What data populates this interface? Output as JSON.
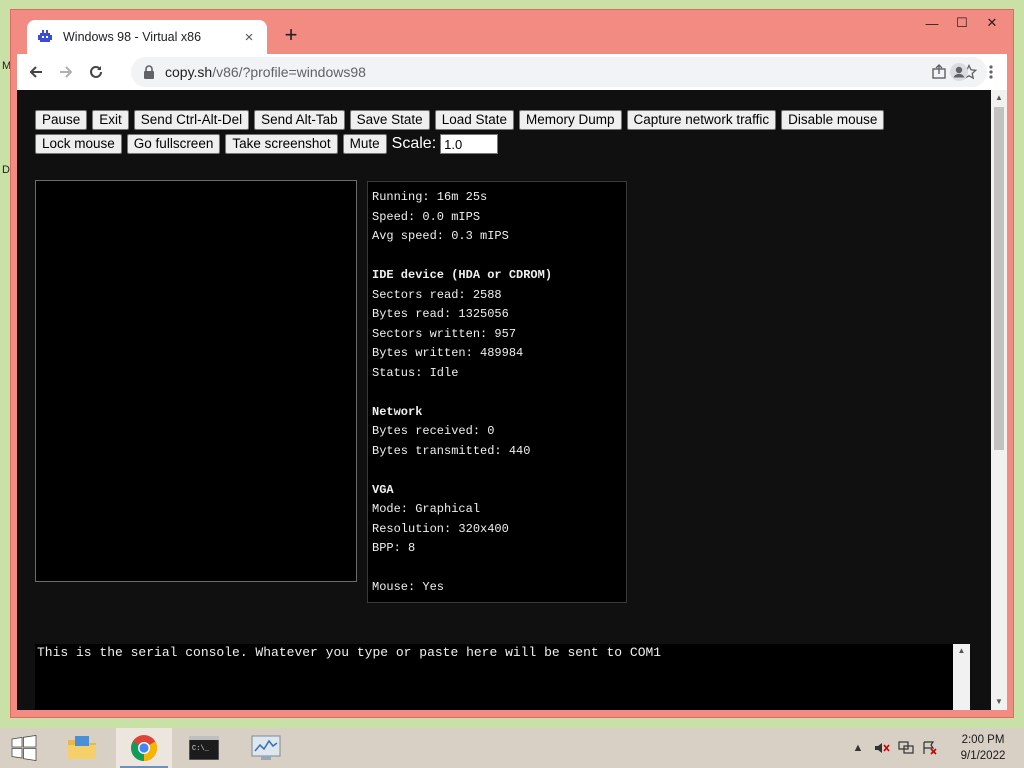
{
  "desktop": {
    "edge_letters": [
      "M",
      "D"
    ]
  },
  "browser": {
    "tab_title": "Windows 98 - Virtual x86",
    "tab_close": "×",
    "new_tab": "+",
    "window_controls": {
      "minimize": "—",
      "maximize": "☐",
      "close": "✕"
    },
    "url_host": "copy.sh",
    "url_path": "/v86/?profile=windows98",
    "icons": [
      "back-icon",
      "forward-icon",
      "reload-icon",
      "lock-icon",
      "share-icon",
      "star-icon",
      "profile-icon",
      "menu-icon"
    ]
  },
  "controls": {
    "row1": [
      "Pause",
      "Exit",
      "Send Ctrl-Alt-Del",
      "Send Alt-Tab",
      "Save State",
      "Load State",
      "Memory Dump",
      "Capture network traffic",
      "Disable mouse"
    ],
    "row2": [
      "Lock mouse",
      "Go fullscreen",
      "Take screenshot",
      "Mute"
    ],
    "scale_label": "Scale:",
    "scale_value": "1.0"
  },
  "stats": {
    "running": "Running: 16m 25s",
    "speed": "Speed: 0.0 mIPS",
    "avg_speed": "Avg speed: 0.3 mIPS",
    "ide_header": "IDE device (HDA or CDROM)",
    "sectors_read": "Sectors read: 2588",
    "bytes_read": "Bytes read: 1325056",
    "sectors_written": "Sectors written: 957",
    "bytes_written": "Bytes written: 489984",
    "status": "Status: Idle",
    "network_header": "Network",
    "bytes_received": "Bytes received: 0",
    "bytes_transmitted": "Bytes transmitted: 440",
    "vga_header": "VGA",
    "mode": "Mode: Graphical",
    "resolution": "Resolution: 320x400",
    "bpp": "BPP: 8",
    "mouse": "Mouse: Yes"
  },
  "console": {
    "text": "This is the serial console. Whatever you type or paste here will be sent to COM1"
  },
  "taskbar": {
    "items": [
      "start-icon",
      "file-explorer-icon",
      "chrome-icon",
      "command-prompt-icon",
      "performance-monitor-icon"
    ],
    "clock_time": "2:00 PM",
    "clock_date": "9/1/2022",
    "tray_chevron": "▲"
  },
  "colors": {
    "titlebar": "#f28b82",
    "page_bg": "#101010",
    "taskbar": "#d8cfc5"
  }
}
